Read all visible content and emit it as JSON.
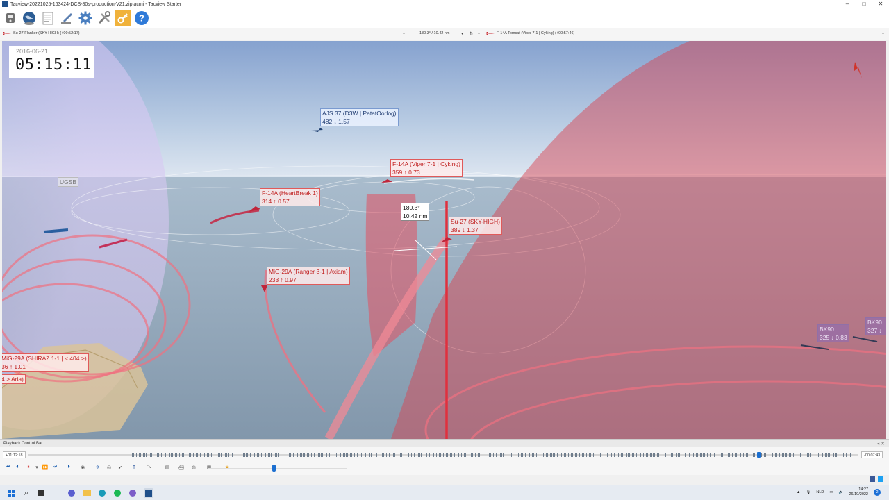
{
  "window": {
    "title": "Tacview-20221025-163424-DCS-80s-production-V21.zip.acmi - Tacview Starter",
    "minimize": "–",
    "maximize": "□",
    "close": "✕"
  },
  "toolbar": {
    "icons": [
      "recorder-icon",
      "globe-icon",
      "document-icon",
      "edit-icon",
      "settings-icon",
      "tools-icon",
      "key-icon",
      "help-icon"
    ],
    "help_glyph": "?"
  },
  "selectors": {
    "primary_object": "Su-27 Flanker (SKY-HIGH) (+00:52:17)",
    "measurement": "180.3° / 10.42 nm",
    "secondary_object": "F-14A Tomcat (Viper 7-1 | Cyking) (+00:57:46)",
    "dropdown_glyph": "▾"
  },
  "viewport": {
    "date": "2016-06-21",
    "time": "05:15:11",
    "labels": {
      "ajs37": {
        "line1": "AJS 37 (D3W | PatatOorlog)",
        "line2": "482 ↓ 1.57"
      },
      "f14_viper": {
        "line1": "F-14A (Viper 7-1 | Cyking)",
        "line2": "359 ↑ 0.73"
      },
      "f14_heartbreak": {
        "line1": "F-14A (HeartBreak 1)",
        "line2": "314 ↑ 0.57"
      },
      "su27": {
        "line1": "Su-27 (SKY-HIGH)",
        "line2": "389 ↓ 1.37"
      },
      "mig29_ranger": {
        "line1": "MiG-29A (Ranger 3-1 | Axiam)",
        "line2": "233 ↑ 0.97"
      },
      "mig29_shiraz": {
        "line1": "MiG-29A (SHIRAZ 1-1 | < 404 >)",
        "line2": "36 ↑ 1.01"
      },
      "aria": {
        "line1": "4 > Aria)"
      },
      "bearing": {
        "line1": "180.3°",
        "line2": "10.42 nm"
      },
      "airbase": "UGSB",
      "bk90_a": {
        "line1": "BK90",
        "line2": "325 ↓ 0.83"
      },
      "bk90_b": {
        "line1": "BK90",
        "line2": "327 ↓"
      }
    },
    "colors": {
      "red_zone": "#d9434f",
      "sky": "#9fb5d3",
      "sea": "#8fa3b5"
    }
  },
  "playback": {
    "bar_title": "Playback Control Bar",
    "bar_buttons": "◂ ✕",
    "start_time": "+01:12:18",
    "end_time": "-00:07:43",
    "progress": 0.88
  },
  "taskbar": {
    "language": "NLD",
    "time": "14:27",
    "date": "26/10/2022",
    "notifications": "2"
  }
}
